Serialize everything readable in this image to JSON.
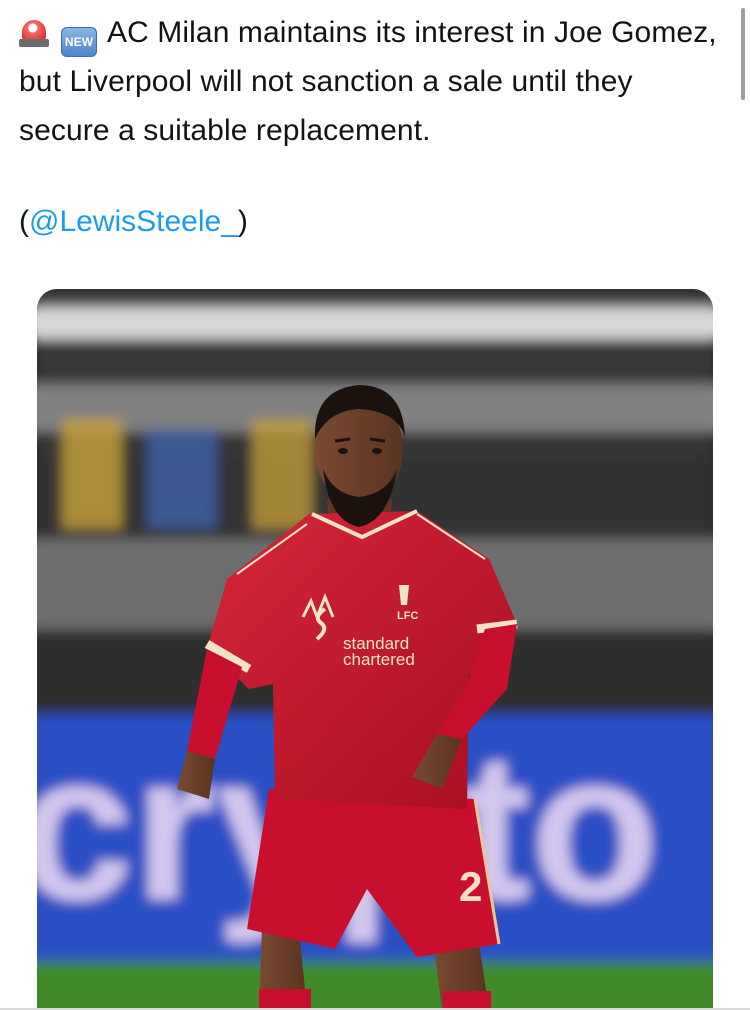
{
  "tweet": {
    "emojis": [
      "police-car-light-icon",
      "new-button-icon"
    ],
    "new_badge_label": "NEW",
    "text": "AC Milan maintains its interest in Joe Gomez, but Liverpool will not sanction a sale until they secure a suitable replacement.",
    "source_open": "(",
    "source_handle": "@LewisSteele_",
    "source_close": ")"
  },
  "photo": {
    "shirt_sponsor_line1": "standard",
    "shirt_sponsor_line2": "chartered",
    "club_crest_text": "LFC",
    "shirt_number": "2",
    "board_text": "crypto"
  },
  "colors": {
    "link": "#1d9bf0",
    "kit_red": "#c8102e",
    "pitch_green": "#3f8a2c",
    "board_blue": "#2b4fc4"
  }
}
